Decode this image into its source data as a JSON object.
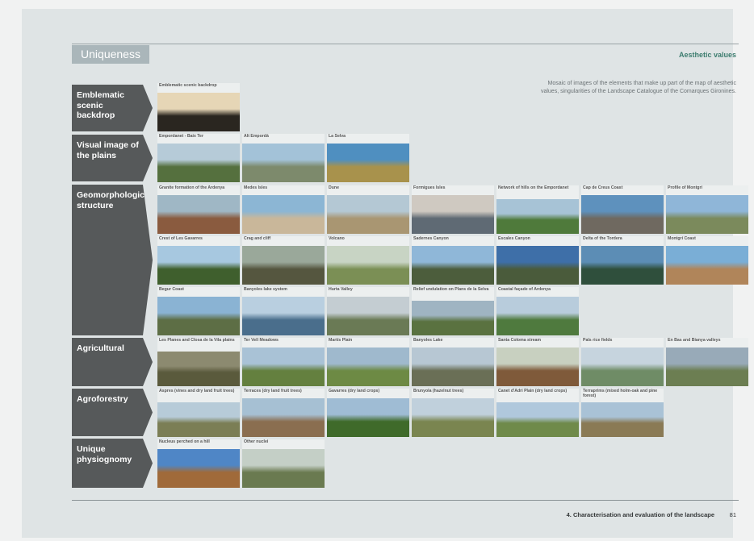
{
  "header": {
    "section_tab": "Uniqueness",
    "aesthetic_label": "Aesthetic values",
    "caption": "Mosaic of images of the elements that make up part of the map of aesthetic values, singularities of the Landscape Catalogue of the Comarques Gironines."
  },
  "footer": {
    "title": "4. Characterisation and evaluation of the landscape",
    "page_number": "81"
  },
  "categories": [
    {
      "label": "Emblematic scenic backdrop"
    },
    {
      "label": "Visual image of the plains"
    },
    {
      "label": "Geomorphological structure"
    },
    {
      "label": "Agricultural"
    },
    {
      "label": "Agroforestry"
    },
    {
      "label": "Unique physiognomy"
    }
  ],
  "tiles": [
    {
      "label": "Emblematic scenic backdrop",
      "sky": "#e6d6b6",
      "ground": "#2a2620"
    },
    {
      "label": "Empordanet - Baix Ter",
      "sky": "#b6cbd8",
      "ground": "#55703e"
    },
    {
      "label": "Alt Empordà",
      "sky": "#a3c2d8",
      "ground": "#7d8a6c"
    },
    {
      "label": "La Selva",
      "sky": "#4f8fc0",
      "ground": "#a8924c"
    },
    {
      "label": "Granite formation of the Ardenya",
      "sky": "#9fb7c5",
      "ground": "#8a5b3f"
    },
    {
      "label": "Medes Isles",
      "sky": "#8cb6d4",
      "ground": "#c9b79a"
    },
    {
      "label": "Dune",
      "sky": "#b4c8d4",
      "ground": "#a99672"
    },
    {
      "label": "Formigues Isles",
      "sky": "#cfc9c1",
      "ground": "#5f6a74"
    },
    {
      "label": "Network of hills on the Empordanet",
      "sky": "#a7c3d6",
      "ground": "#4f7a3b"
    },
    {
      "label": "Cap de Creus Coast",
      "sky": "#5e91bd",
      "ground": "#6f6960"
    },
    {
      "label": "Profile of Montgrí",
      "sky": "#8fb6d8",
      "ground": "#7b8a5c"
    },
    {
      "label": "Crest of Les Gavarres",
      "sky": "#a7c8e0",
      "ground": "#3f5f2d"
    },
    {
      "label": "Crag and cliff",
      "sky": "#9aa89a",
      "ground": "#55563f"
    },
    {
      "label": "Volcano",
      "sky": "#c8d4c4",
      "ground": "#7b8f55"
    },
    {
      "label": "Sadernes Canyon",
      "sky": "#8fb7d8",
      "ground": "#4c5d3c"
    },
    {
      "label": "Escales Canyon",
      "sky": "#3e6fa8",
      "ground": "#4a5b3b"
    },
    {
      "label": "Delta of the Tordera",
      "sky": "#5c8db5",
      "ground": "#2f4f3c"
    },
    {
      "label": "Montgrí Coast",
      "sky": "#7aaed6",
      "ground": "#b0855a"
    },
    {
      "label": "Begur Coast",
      "sky": "#8ab3d3",
      "ground": "#5d6e45"
    },
    {
      "label": "Banyoles lake system",
      "sky": "#b9cfe0",
      "ground": "#4a6e8c"
    },
    {
      "label": "Hurta Valley",
      "sky": "#c4cdd2",
      "ground": "#6a7a55"
    },
    {
      "label": "Relief undulation on Plans de la Selva",
      "sky": "#9fb4c2",
      "ground": "#5a7240"
    },
    {
      "label": "Coastal façade of Ardenya",
      "sky": "#b8ccdc",
      "ground": "#4f7a3e"
    },
    {
      "label": "Les Planes and Closa de la Vila plains",
      "sky": "#8c8a70",
      "ground": "#5a5a3c"
    },
    {
      "label": "Ter Vell Meadows",
      "sky": "#a9c2d6",
      "ground": "#64803f"
    },
    {
      "label": "Martís Plain",
      "sky": "#9fb9cd",
      "ground": "#6d8a44"
    },
    {
      "label": "Banyoles Lake",
      "sky": "#b7c7d3",
      "ground": "#6a6f56"
    },
    {
      "label": "Santa Coloma stream",
      "sky": "#c8d0c0",
      "ground": "#7f5a3a"
    },
    {
      "label": "Pals rice fields",
      "sky": "#c6d4de",
      "ground": "#6f8c66"
    },
    {
      "label": "En Bas and Bianya valleys",
      "sky": "#98aab8",
      "ground": "#6c7e52"
    },
    {
      "label": "Aspres (vines and dry land fruit trees)",
      "sky": "#b7cbd8",
      "ground": "#7b7e55"
    },
    {
      "label": "Terraces (dry land fruit trees)",
      "sky": "#a6c0d3",
      "ground": "#8a6e50"
    },
    {
      "label": "Gavarres (dry land crops)",
      "sky": "#9fbcd4",
      "ground": "#3f6a2a"
    },
    {
      "label": "Brunyola (hazelnut trees)",
      "sky": "#c0d0dc",
      "ground": "#7a8550"
    },
    {
      "label": "Canet d'Adri Plain (dry land crops)",
      "sky": "#b0c8dc",
      "ground": "#6f8a4a"
    },
    {
      "label": "Terraprims (mixed holm-oak and pine forest)",
      "sky": "#a9c2d6",
      "ground": "#8a7a55"
    },
    {
      "label": "Nucleus perched on a hill",
      "sky": "#4f86c6",
      "ground": "#a06a3a"
    },
    {
      "label": "Other nuclei",
      "sky": "#c4cfc6",
      "ground": "#6a7a50"
    }
  ]
}
